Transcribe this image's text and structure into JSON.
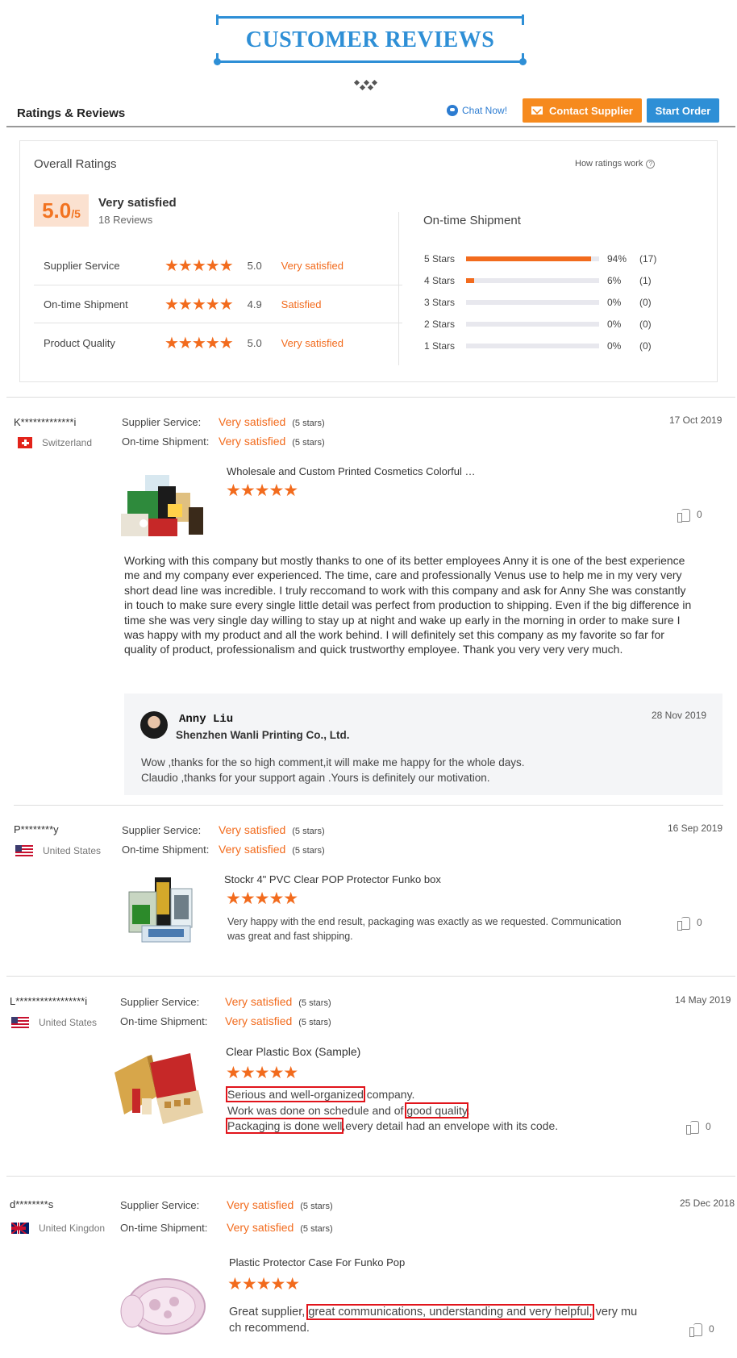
{
  "banner": {
    "title": "CUSTOMER REVIEWS"
  },
  "header": {
    "title": "Ratings & Reviews",
    "chat_label": "Chat Now!",
    "contact_label": "Contact Supplier",
    "order_label": "Start Order"
  },
  "colors": {
    "accent_orange": "#f26b1d",
    "brand_blue": "#2e8fd6",
    "button_orange": "#f68a1e",
    "highlight_red": "#e1141b"
  },
  "overall": {
    "title": "Overall Ratings",
    "how_label": "How ratings work",
    "score": "5.0",
    "score_of": "/5",
    "score_desc": "Very satisfied",
    "reviews_count": "18 Reviews",
    "ratings": [
      {
        "label": "Supplier Service",
        "stars": "★★★★★",
        "value": "5.0",
        "desc": "Very satisfied"
      },
      {
        "label": "On-time Shipment",
        "stars": "★★★★★",
        "value": "4.9",
        "desc": "Satisfied"
      },
      {
        "label": "Product Quality",
        "stars": "★★★★★",
        "value": "5.0",
        "desc": "Very satisfied"
      }
    ],
    "shipment": {
      "title": "On-time Shipment",
      "bars": [
        {
          "label": "5 Stars",
          "fill": 0.94,
          "pct": "94%",
          "count": "(17)"
        },
        {
          "label": "4 Stars",
          "fill": 0.06,
          "pct": "6%",
          "count": "(1)"
        },
        {
          "label": "3 Stars",
          "fill": 0,
          "pct": "0%",
          "count": "(0)"
        },
        {
          "label": "2 Stars",
          "fill": 0,
          "pct": "0%",
          "count": "(0)"
        },
        {
          "label": "1 Stars",
          "fill": 0,
          "pct": "0%",
          "count": "(0)"
        }
      ]
    }
  },
  "meta_labels": {
    "supplier": "Supplier Service:",
    "shipment": "On-time Shipment:"
  },
  "reviews": [
    {
      "name": "K*************i",
      "country": "Switzerland",
      "date": "17 Oct 2019",
      "supplier_value": "Very satisfied",
      "supplier_stars": "(5 stars)",
      "shipment_value": "Very satisfied",
      "shipment_stars": "(5 stars)",
      "product": "Wholesale and Custom Printed Cosmetics Colorful …",
      "stars": "★★★★★",
      "likes": "0",
      "text": "Working with this company but mostly thanks to one of its better employees Anny it is one of the best experience me and my company ever experienced. The time, care and professionally Venus use to help me in my very very short dead line was incredible. I truly reccomand to work with this company and ask for Anny She was constantly in touch to make sure every single little detail was perfect from production to shipping. Even if the big difference in time she was very single day willing to stay up at night and wake up early in the morning in order to make sure I was happy with my product and all the work behind. I will definitely set this company as my favorite so far for quality of product, professionalism and quick trustworthy employee. Thank you very very very much.",
      "reply": {
        "name": "Anny Liu",
        "company": "Shenzhen Wanli Printing Co., Ltd.",
        "date": "28 Nov 2019",
        "line1": "Wow ,thanks for the so high comment,it will make me happy for the whole days.",
        "line2": "Claudio ,thanks for your support again .Yours is definitely our motivation."
      }
    },
    {
      "name": "P********y",
      "country": "United States",
      "date": "16 Sep 2019",
      "supplier_value": "Very satisfied",
      "supplier_stars": "(5 stars)",
      "shipment_value": "Very satisfied",
      "shipment_stars": "(5 stars)",
      "product": "Stockr 4\" PVC Clear POP Protector Funko box",
      "stars": "★★★★★",
      "likes": "0",
      "line1": "Very happy with the end result, packaging was exactly as we requested. Communication",
      "line2": "was great and fast shipping."
    },
    {
      "name": "L*****************i",
      "country": "United States",
      "date": "14 May 2019",
      "supplier_value": "Very satisfied",
      "supplier_stars": "(5 stars)",
      "shipment_value": "Very satisfied",
      "shipment_stars": "(5 stars)",
      "product": "Clear Plastic Box (Sample)",
      "stars": "★★★★★",
      "likes": "0",
      "l1_hl": "Serious and well-organized",
      "l1_rest": " company.",
      "l2_pre": "Work was done on schedule and of ",
      "l2_hl": "good quality",
      "l2_rest": ".",
      "l3_hl": "Packaging is done well",
      "l3_rest": ",every detail had an envelope with its code."
    },
    {
      "name": "d********s",
      "country": "United Kingdon",
      "date": "25 Dec 2018",
      "supplier_value": "Very satisfied",
      "supplier_stars": "(5 stars)",
      "shipment_value": "Very satisfied",
      "shipment_stars": "(5 stars)",
      "product": "Plastic Protector Case For Funko Pop",
      "stars": "★★★★★",
      "likes": "0",
      "l1_pre": "Great supplier, ",
      "l1_hl": "great communications, understanding and very helpful,",
      "l1_rest": " very mu",
      "line2": "ch recommend."
    }
  ]
}
